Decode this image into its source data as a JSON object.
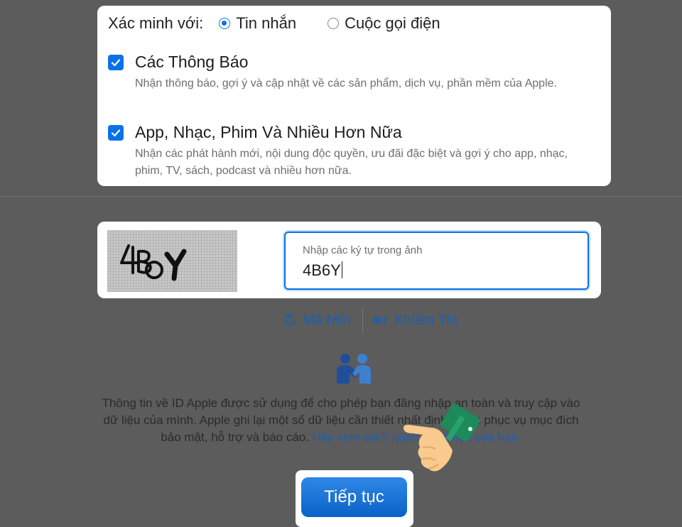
{
  "verify": {
    "label": "Xác minh với:",
    "options": [
      {
        "label": "Tin nhắn",
        "selected": true
      },
      {
        "label": "Cuộc gọi điện",
        "selected": false
      }
    ]
  },
  "subscriptions": [
    {
      "title": "Các Thông Báo",
      "description": "Nhận thông báo, gợi ý và cập nhật về các sản phẩm, dịch vụ, phần mềm của Apple.",
      "checked": true
    },
    {
      "title": "App, Nhạc, Phim Và Nhiều Hơn Nữa",
      "description": "Nhận các phát hành mới, nội dung độc quyền, ưu đãi đặc biệt và gợi ý cho app, nhạc, phim, TV, sách, podcast và nhiều hơn nữa.",
      "checked": true
    }
  ],
  "captcha": {
    "image_text": "4B6Y",
    "field_label": "Nhập các ký tự trong ảnh",
    "field_value": "4B6Y",
    "new_code_label": "Mã Mới",
    "audio_label": "Khiếm Thị"
  },
  "info": {
    "text": "Thông tin về ID Apple được sử dụng để cho phép bạn đăng nhập an toàn và truy cập vào dữ liệu của mình. Apple ghi lại một số dữ liệu cần thiết nhất định nhằm phục vụ mục đích bảo mật, hỗ trợ và báo cáo.",
    "link": "Hãy xem cách quản lý dữ liệu của bạn."
  },
  "continue_label": "Tiếp tục",
  "colors": {
    "accent": "#0a72e6",
    "link": "#1f5fae",
    "overlay": "#5c5c5c"
  },
  "icons": [
    "radio-icon",
    "checkbox-check-icon",
    "refresh-icon",
    "speaker-icon",
    "people-handshake-icon",
    "pointing-hand-icon"
  ]
}
